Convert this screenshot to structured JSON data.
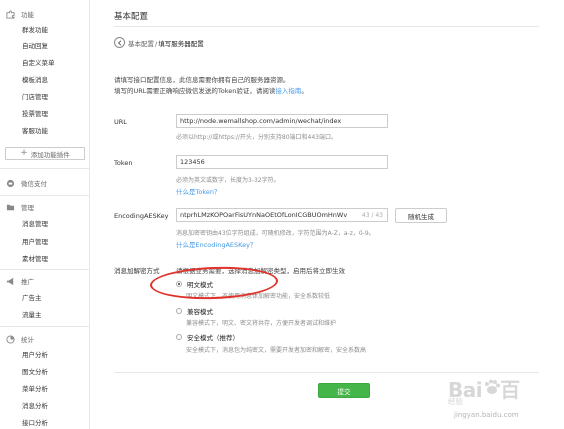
{
  "sidebar": {
    "groups": [
      {
        "label": "功能",
        "icon": "puzzle-icon",
        "items": [
          "群发功能",
          "自动回复",
          "自定义菜单",
          "模板消息",
          "门店管理",
          "投票管理",
          "客服功能"
        ]
      },
      {
        "label": "微信支付",
        "icon": "wallet-icon",
        "items": []
      },
      {
        "label": "管理",
        "icon": "folder-icon",
        "items": [
          "消息管理",
          "用户管理",
          "素材管理"
        ]
      },
      {
        "label": "推广",
        "icon": "megaphone-icon",
        "items": [
          "广告主",
          "流量主"
        ]
      },
      {
        "label": "统计",
        "icon": "chart-icon",
        "items": [
          "用户分析",
          "图文分析",
          "菜单分析",
          "消息分析",
          "接口分析"
        ]
      }
    ],
    "plugin_button": "添加功能插件"
  },
  "main": {
    "title": "基本配置",
    "breadcrumb": {
      "parent": "基本配置",
      "separator": "/",
      "current": "填写服务器配置"
    },
    "intro": {
      "line1": "请填写接口配置信息，此信息需要你拥有自己的服务器资源。",
      "line2_prefix": "填写的URL需要正确响应微信发送的Token验证，请阅读",
      "line2_link": "接入指南",
      "line2_suffix": "。"
    },
    "url": {
      "label": "URL",
      "value": "http://node.wemallshop.com/admin/wechat/index",
      "hint": "必须以http://或https://开头，分别支持80端口和443端口。"
    },
    "token": {
      "label": "Token",
      "value": "123456",
      "hint": "必须为英文或数字，长度为3-32字符。",
      "link": "什么是Token？"
    },
    "aeskey": {
      "label": "EncodingAESKey",
      "value": "ntprhLMzKOPOarFisUYnNaOEtOfLonICGBUOmHnWv",
      "count": "43 / 43",
      "random_button": "随机生成",
      "hint": "消息加密密钥由43位字符组成，可随机修改，字符范围为A-Z，a-z，0-9。",
      "link": "什么是EncodingAESKey？"
    },
    "encrypt": {
      "label": "消息加解密方式",
      "prompt": "请根据业务需要，选择消息加解密类型，启用后将立即生效",
      "options": [
        {
          "label": "明文模式",
          "hint": "明文模式下，不使用消息体加解密功能，安全系数较低",
          "checked": true
        },
        {
          "label": "兼容模式",
          "hint": "兼容模式下，明文、密文将共存，方便开发者调试和维护",
          "checked": false
        },
        {
          "label": "安全模式（推荐）",
          "hint": "安全模式下，消息包为纯密文，需要开发者加密和解密，安全系数高",
          "checked": false
        }
      ]
    },
    "submit_button": "提交"
  },
  "watermark": {
    "logo_left": "Bai",
    "logo_right": "百",
    "sub": "经验",
    "url": "jingyan.baidu.com"
  },
  "colors": {
    "link": "#459ae9",
    "submit_bg": "#44b549",
    "annotation": "#e0322a"
  }
}
